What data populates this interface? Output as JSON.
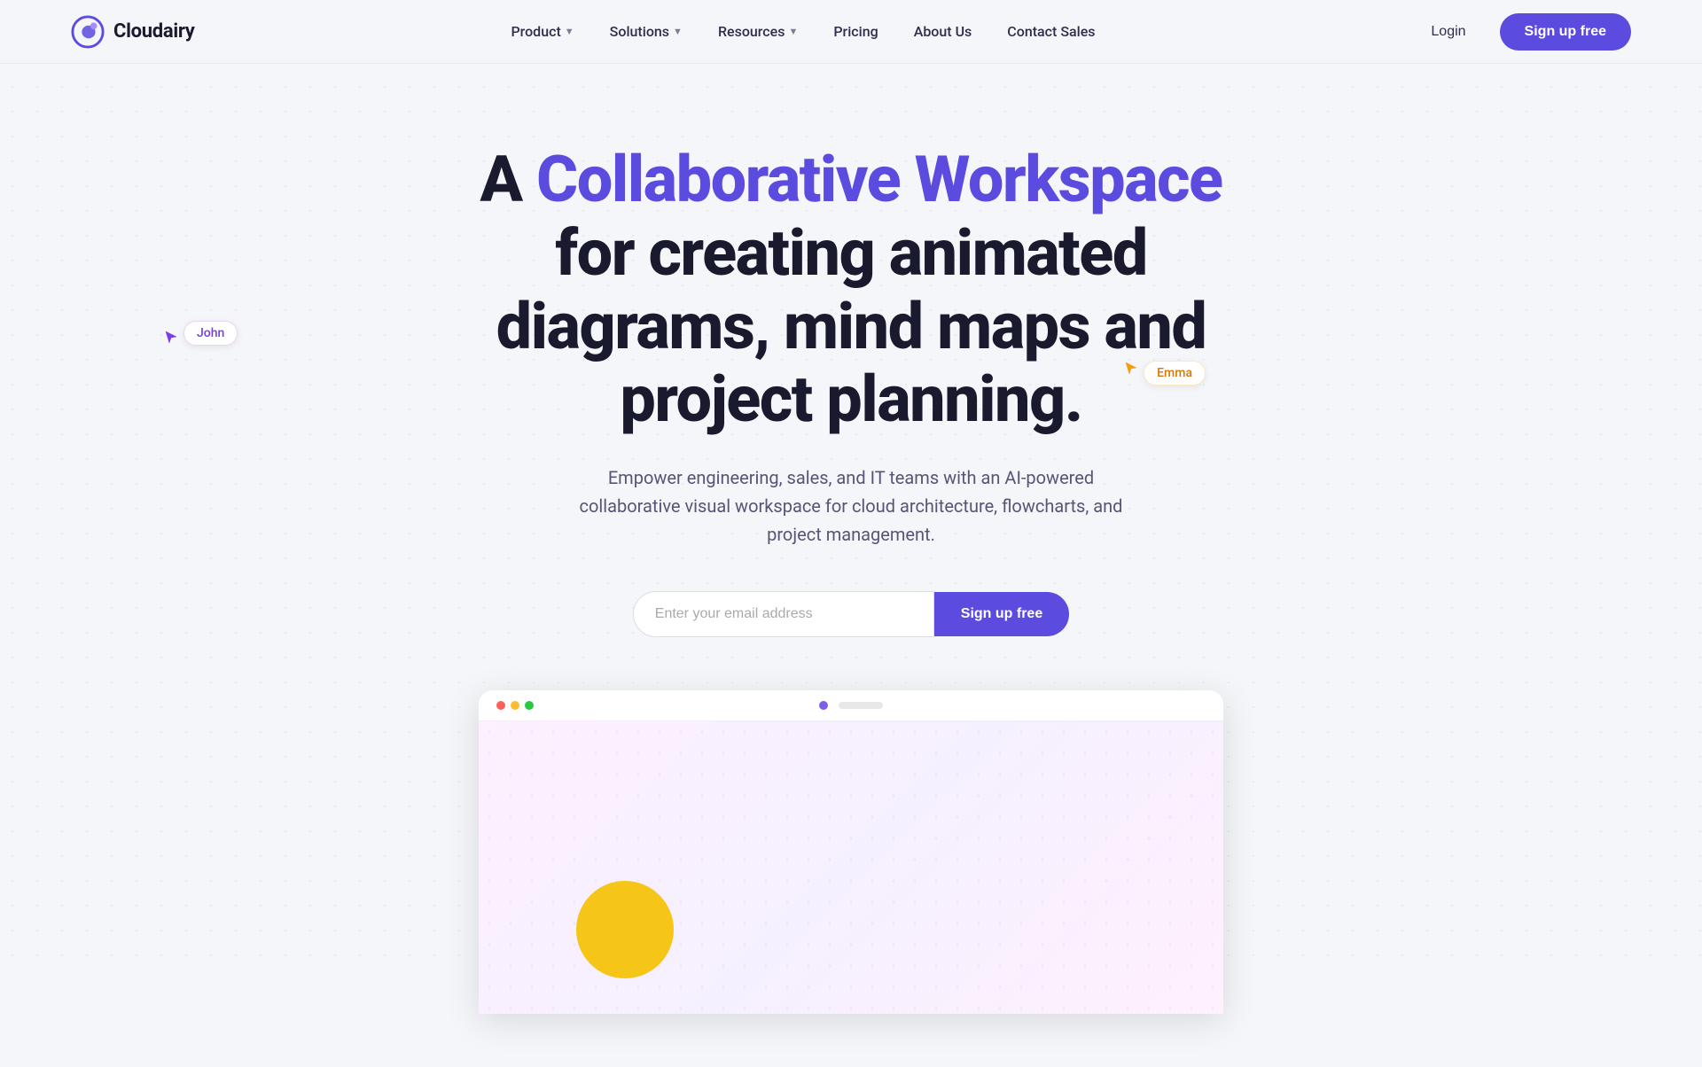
{
  "brand": {
    "name": "Cloudairy"
  },
  "nav": {
    "links": [
      {
        "label": "Product",
        "has_dropdown": true
      },
      {
        "label": "Solutions",
        "has_dropdown": true
      },
      {
        "label": "Resources",
        "has_dropdown": true
      },
      {
        "label": "Pricing",
        "has_dropdown": false
      },
      {
        "label": "About Us",
        "has_dropdown": false
      },
      {
        "label": "Contact Sales",
        "has_dropdown": false
      }
    ],
    "login_label": "Login",
    "signup_label": "Sign up free"
  },
  "hero": {
    "title_part1": "A ",
    "title_highlight": "Collaborative Workspace",
    "title_part2": " for creating animated diagrams, mind maps and project planning.",
    "subtitle": "Empower engineering, sales, and IT teams with an AI-powered collaborative visual workspace for cloud architecture, flowcharts, and project management.",
    "email_placeholder": "Enter your email address",
    "signup_label": "Sign up free"
  },
  "cursors": {
    "john": {
      "label": "John",
      "color": "#7c3aed"
    },
    "emma": {
      "label": "Emma",
      "color": "#d97706"
    }
  },
  "preview": {
    "titlebar_dots": [
      "red",
      "yellow",
      "green"
    ],
    "canvas_bg": "#fdf0ff"
  }
}
